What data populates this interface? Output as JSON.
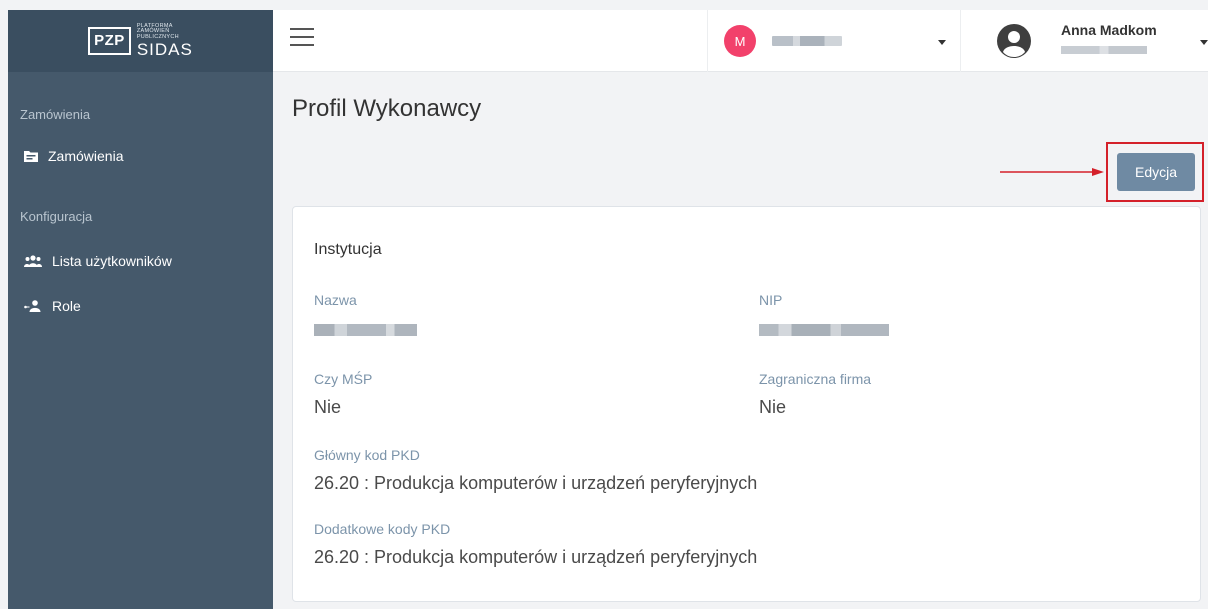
{
  "sidebar": {
    "logo": {
      "pzp": "PZP",
      "small_lines": [
        "PLATFORMA",
        "ZAMÓWIEŃ",
        "PUBLICZNYCH"
      ],
      "sidas": "SIDAS"
    },
    "sections": [
      {
        "title": "Zamówienia",
        "items": [
          {
            "label": "Zamówienia",
            "icon": "folder-icon"
          }
        ]
      },
      {
        "title": "Konfiguracja",
        "items": [
          {
            "label": "Lista użytkowników",
            "icon": "users-icon"
          },
          {
            "label": "Role",
            "icon": "user-role-icon"
          }
        ]
      }
    ]
  },
  "topbar": {
    "org_avatar_letter": "M",
    "user_name": "Anna Madkom"
  },
  "main": {
    "title": "Profil Wykonawcy",
    "edit_label": "Edycja"
  },
  "card": {
    "title": "Instytucja",
    "fields": {
      "nazwa_label": "Nazwa",
      "nip_label": "NIP",
      "msp_label": "Czy MŚP",
      "msp_value": "Nie",
      "zagr_label": "Zagraniczna firma",
      "zagr_value": "Nie",
      "pkd_label": "Główny kod PKD",
      "pkd_value": "26.20 : Produkcja komputerów i urządzeń peryferyjnych",
      "extra_pkd_label": "Dodatkowe kody PKD",
      "extra_pkd_value": "26.20 : Produkcja komputerów i urządzeń peryferyjnych"
    }
  },
  "colors": {
    "sidebar": "#45596b",
    "accent_button": "#6f8aa3",
    "avatar": "#f2416b",
    "annotation_red": "#d4202a"
  }
}
